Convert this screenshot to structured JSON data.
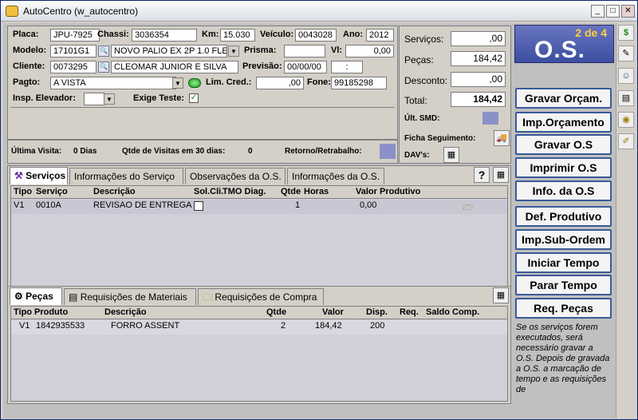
{
  "window": {
    "title": "AutoCentro (w_autocentro)",
    "min": "_",
    "max": "□",
    "close": "✕"
  },
  "form": {
    "placa_label": "Placa:",
    "placa": "JPU-7925",
    "chassi_label": "Chassi:",
    "chassi": "3036354",
    "km_label": "Km:",
    "km": "15.030",
    "veiculo_label": "Veículo:",
    "veiculo": "0043028",
    "ano_label": "Ano:",
    "ano": "2012",
    "modelo_label": "Modelo:",
    "modelo_code": "17101G1",
    "modelo_desc": "NOVO PALIO EX 2P 1.0 FLEX",
    "prisma_label": "Prisma:",
    "prisma": "",
    "vl_label": "Vl:",
    "vl": "0,00",
    "cliente_label": "Cliente:",
    "cliente_code": "0073295",
    "cliente_name": "CLEOMAR JUNIOR E SILVA",
    "previsao_label": "Previsão:",
    "previsao_date": "00/00/00",
    "previsao_time": ":",
    "pagto_label": "Pagto:",
    "pagto": "A VISTA",
    "limcred_label": "Lim. Cred.:",
    "limcred": ",00",
    "fone_label": "Fone:",
    "fone": "99185298",
    "insp_label": "Insp. Elevador:",
    "insp": "",
    "exige_label": "Exige Teste:",
    "exige_checked": "✓"
  },
  "totals": {
    "servicos_label": "Serviços:",
    "servicos": ",00",
    "pecas_label": "Peças:",
    "pecas": "184,42",
    "desconto_label": "Desconto:",
    "desconto": ",00",
    "total_label": "Total:",
    "total": "184,42",
    "ult_smd_label": "Últ. SMD:",
    "ficha_label": "Ficha Seguimento:",
    "davs_label": "DAV's:"
  },
  "os_badge": {
    "counter": "2 de 4",
    "title": "O.S.",
    "color": "#4a5aa8"
  },
  "visits": {
    "ultima_label": "Última Visita:",
    "ultima_value": "0 Dias",
    "qtde_label": "Qtde de Visitas em 30 dias:",
    "qtde_value": "0",
    "retorno_label": "Retorno/Retrabalho:"
  },
  "service_tabs": [
    "Serviços",
    "Informações do Serviço",
    "Observações da O.S.",
    "Informações da O.S."
  ],
  "service_help": "?",
  "service_grid": {
    "headers": [
      "Tipo",
      "Serviço",
      "Descrição",
      "Sol.Cli.",
      "TMO Diag.",
      "Qtde",
      "Horas",
      "Valor",
      "Produtivo"
    ],
    "rows": [
      {
        "tipo": "V1",
        "servico": "0010A",
        "descricao": "REVISAO DE ENTREGA",
        "qtde": "1",
        "valor": "0,00"
      }
    ]
  },
  "parts_tabs": [
    "Peças",
    "Requisições de Materiais",
    "Requisições de Compra"
  ],
  "parts_grid": {
    "headers": [
      "Tipo",
      "Produto",
      "Descrição",
      "Qtde",
      "Valor",
      "Disp.",
      "Req.",
      "Saldo",
      "Comp."
    ],
    "rows": [
      {
        "tipo": "V1",
        "produto": "1842935533",
        "descricao": "FORRO ASSENT",
        "qtde": "2",
        "valor": "184,42",
        "disp": "200"
      }
    ]
  },
  "actions": [
    "Gravar Orçam.",
    "Imp.Orçamento",
    "Gravar O.S",
    "Imprimir O.S",
    "Info. da O.S",
    "Def. Produtivo",
    "Imp.Sub-Ordem",
    "Iniciar Tempo",
    "Parar Tempo",
    "Req. Peças"
  ],
  "hint": "Se os serviços forem executados, será necessário gravar a O.S. Depois de gravada a O.S. a marcação de tempo e as requisições de",
  "side_icons": [
    "$",
    "✎",
    "☺",
    "▤",
    "◉",
    "✐"
  ]
}
